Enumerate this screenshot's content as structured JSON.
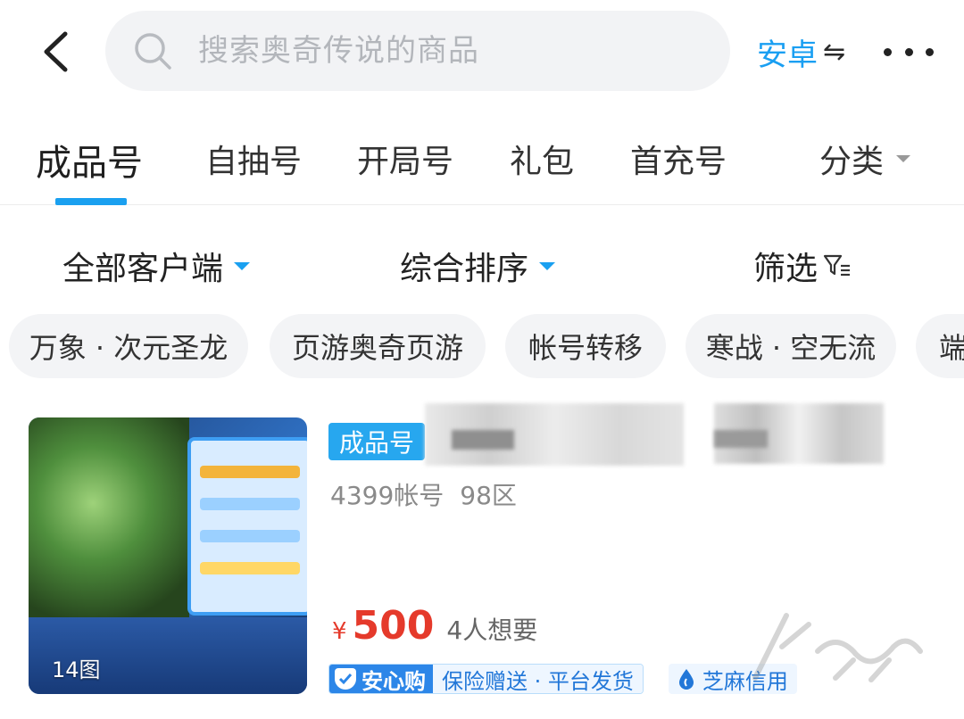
{
  "header": {
    "search_placeholder": "搜索奥奇传说的商品",
    "platform_label": "安卓",
    "platform_switch_icon": "⇋"
  },
  "tabs": {
    "items": [
      {
        "label": "成品号",
        "active": true
      },
      {
        "label": "自抽号",
        "active": false
      },
      {
        "label": "开局号",
        "active": false
      },
      {
        "label": "礼包",
        "active": false
      },
      {
        "label": "首充号",
        "active": false
      }
    ],
    "category_label": "分类"
  },
  "filters": {
    "client": "全部客户端",
    "sort": "综合排序",
    "filter": "筛选"
  },
  "chips": [
    "万象 · 次元圣龙",
    "页游奥奇页游",
    "帐号转移",
    "寒战 · 空无流",
    "端"
  ],
  "product": {
    "type_tag": "成品号",
    "account_source": "4399帐号",
    "server": "98区",
    "image_count": "14图",
    "currency": "¥",
    "price": "500",
    "wants": "4人想要",
    "secure_badge": "安心购",
    "secure_desc": "保险赠送 · 平台发货",
    "credit_badge": "芝麻信用"
  },
  "colors": {
    "accent": "#1aa0f0",
    "price": "#e53a2b",
    "badge_blue": "#2c86e8"
  }
}
